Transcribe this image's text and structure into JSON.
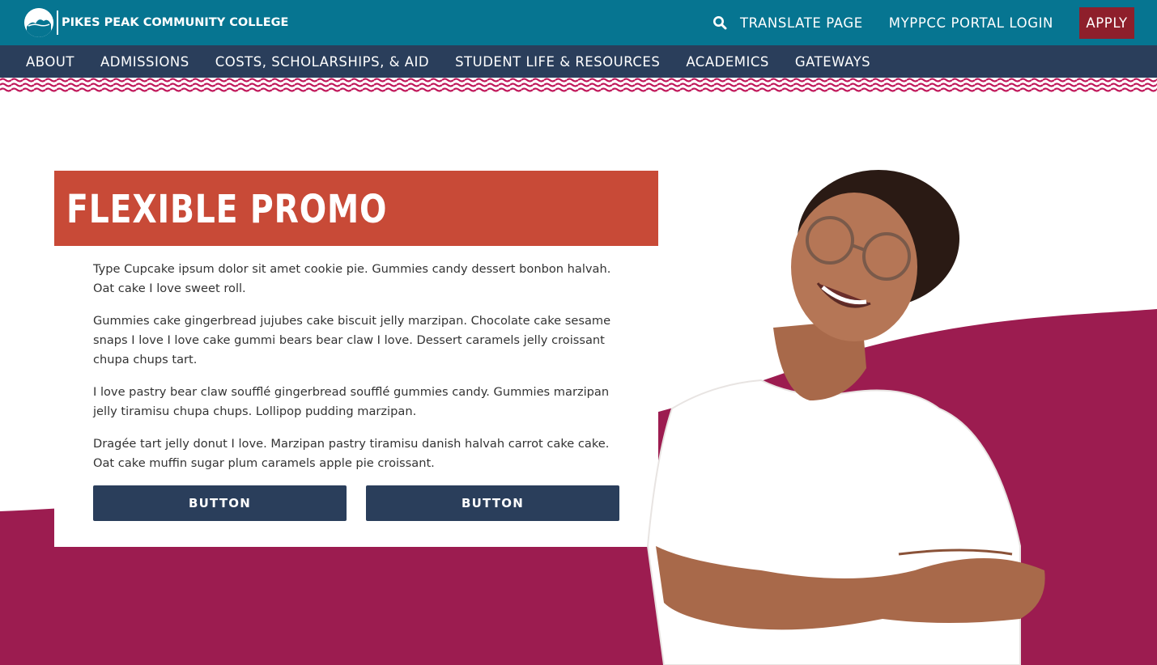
{
  "header": {
    "logo_text": "PIKES PEAK COMMUNITY COLLEGE",
    "utility_links": {
      "translate": "TRANSLATE PAGE",
      "portal": "MYPPCC PORTAL LOGIN"
    },
    "apply_label": "APPLY"
  },
  "nav": {
    "items": [
      {
        "label": "ABOUT"
      },
      {
        "label": "ADMISSIONS"
      },
      {
        "label": "COSTS, SCHOLARSHIPS, & AID"
      },
      {
        "label": "STUDENT LIFE & RESOURCES"
      },
      {
        "label": "ACADEMICS"
      },
      {
        "label": "GATEWAYS"
      }
    ]
  },
  "promo": {
    "title": "FLEXIBLE PROMO",
    "paragraphs": [
      "Type Cupcake ipsum dolor sit amet cookie pie. Gummies candy dessert bonbon halvah. Oat cake I love sweet roll.",
      "Gummies cake gingerbread jujubes cake biscuit jelly marzipan. Chocolate cake sesame snaps I love I love cake gummi bears bear claw I love. Dessert caramels jelly croissant chupa chups tart.",
      "I love pastry bear claw soufflé gingerbread soufflé gummies candy. Gummies marzipan jelly tiramisu chupa chups. Lollipop pudding marzipan.",
      "Dragée tart jelly donut I love. Marzipan pastry tiramisu danish halvah carrot cake cake. Oat cake muffin sugar plum caramels apple pie croissant."
    ],
    "buttons": [
      {
        "label": "BUTTON"
      },
      {
        "label": "BUTTON"
      }
    ]
  },
  "icons": {
    "search": "search-icon",
    "logo": "college-logo-icon"
  },
  "colors": {
    "topbar": "#067591",
    "nav": "#2a3e5b",
    "apply": "#8e1f2b",
    "promo_title": "#c84a37",
    "wave_pink": "#c0185a",
    "background_shape": "#9c1c50",
    "button": "#2a3e5b"
  }
}
